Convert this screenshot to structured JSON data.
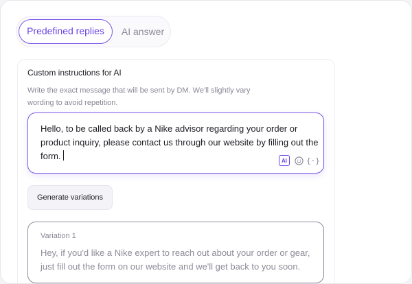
{
  "tabs": [
    {
      "label": "Predefined replies",
      "active": true
    },
    {
      "label": "AI answer",
      "active": false
    }
  ],
  "card": {
    "title": "Custom instructions for AI",
    "description": "Write the exact message that will be sent by DM. We'll slightly vary wording to avoid repetition."
  },
  "message": {
    "text": "Hello, to be called back by a Nike advisor regarding your order or product inquiry, please contact us through our website by filling out the form.",
    "tools": {
      "ai_label": "AI",
      "emoji_icon": "smiley-icon",
      "variables_label": "{·}"
    }
  },
  "generate_button": {
    "label": "Generate variations"
  },
  "variations": [
    {
      "title": "Variation 1",
      "text": "Hey, if you'd like a Nike expert to reach out about your order or gear, just fill out the form on our website and we'll get back to you soon."
    }
  ],
  "colors": {
    "accent": "#6a43e6",
    "accent_border": "#7a56ea",
    "muted_text": "#8a8796",
    "body_text": "#1d1b22"
  }
}
